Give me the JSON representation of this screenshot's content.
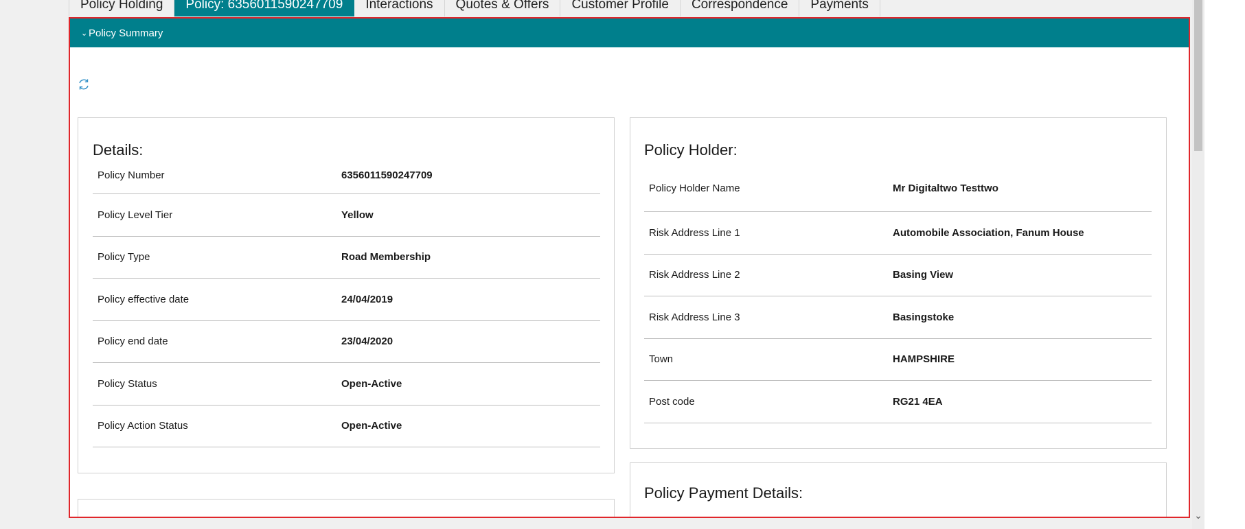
{
  "tabs": [
    {
      "label": "Policy Holding",
      "active": false
    },
    {
      "label": "Policy: 6356011590247709",
      "active": true
    },
    {
      "label": "Interactions",
      "active": false
    },
    {
      "label": "Quotes & Offers",
      "active": false
    },
    {
      "label": "Customer Profile",
      "active": false
    },
    {
      "label": "Correspondence",
      "active": false
    },
    {
      "label": "Payments",
      "active": false
    }
  ],
  "summary": {
    "header_label": "Policy Summary",
    "refresh_icon": "refresh-icon"
  },
  "details": {
    "title": "Details:",
    "rows": [
      {
        "label": "Policy Number",
        "value": "6356011590247709"
      },
      {
        "label": "Policy Level Tier",
        "value": "Yellow"
      },
      {
        "label": "Policy Type",
        "value": "Road Membership"
      },
      {
        "label": "Policy effective date",
        "value": "24/04/2019"
      },
      {
        "label": "Policy end date",
        "value": "23/04/2020"
      },
      {
        "label": "Policy Status",
        "value": "Open-Active"
      },
      {
        "label": "Policy Action Status",
        "value": "Open-Active"
      }
    ]
  },
  "policy_holder": {
    "title": "Policy Holder:",
    "rows": [
      {
        "label": "Policy Holder Name",
        "value": "Mr  Digitaltwo Testtwo"
      },
      {
        "label": "Risk Address Line 1",
        "value": "Automobile Association, Fanum House"
      },
      {
        "label": "Risk Address Line 2",
        "value": "Basing View"
      },
      {
        "label": "Risk Address Line 3",
        "value": "Basingstoke"
      },
      {
        "label": "Town",
        "value": "HAMPSHIRE"
      },
      {
        "label": "Post code",
        "value": "RG21 4EA"
      }
    ]
  },
  "payment_details": {
    "title": "Policy Payment Details:"
  },
  "colors": {
    "accent": "#007f8c",
    "frame_border": "#e0262b"
  }
}
